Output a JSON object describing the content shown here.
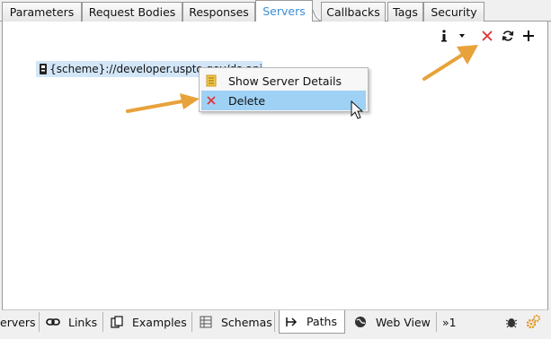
{
  "top_tabs": [
    {
      "label": "Parameters",
      "active": false
    },
    {
      "label": "Request Bodies",
      "active": false
    },
    {
      "label": "Responses",
      "active": false
    },
    {
      "label": "Servers",
      "active": true
    },
    {
      "label": "Callbacks",
      "active": false
    },
    {
      "label": "Tags",
      "active": false
    },
    {
      "label": "Security",
      "active": false
    }
  ],
  "toolbar": {
    "info_icon": "info-icon",
    "dropdown_icon": "chevron-down-icon",
    "delete_icon": "close-icon",
    "refresh_icon": "refresh-icon",
    "add_icon": "plus-icon",
    "delete_color": "#e03030"
  },
  "server_list": {
    "items": [
      {
        "text": "{scheme}://developer.uspto.gov/ds-api",
        "icon": "server-icon",
        "selected": true
      }
    ]
  },
  "context_menu": {
    "items": [
      {
        "label": "Show Server Details",
        "icon": "document-icon",
        "highlighted": false
      },
      {
        "label": "Delete",
        "icon": "close-icon",
        "highlighted": true
      }
    ]
  },
  "bottom_tabs": [
    {
      "label": "ervers",
      "icon": "",
      "active": false
    },
    {
      "label": "Links",
      "icon": "link-icon",
      "active": false
    },
    {
      "label": "Examples",
      "icon": "examples-icon",
      "active": false
    },
    {
      "label": "Schemas",
      "icon": "schemas-icon",
      "active": false
    },
    {
      "label": "Paths",
      "icon": "paths-icon",
      "active": true
    },
    {
      "label": "Web View",
      "icon": "globe-icon",
      "active": false
    },
    {
      "label": "»1",
      "icon": "",
      "active": false
    }
  ],
  "status_icons": [
    "bug-icon",
    "gears-icon"
  ],
  "colors": {
    "accent": "#3b8ed8",
    "selection": "#d3e6f8",
    "menu_highlight": "#9fd1f5",
    "arrow": "#e8a23a"
  }
}
